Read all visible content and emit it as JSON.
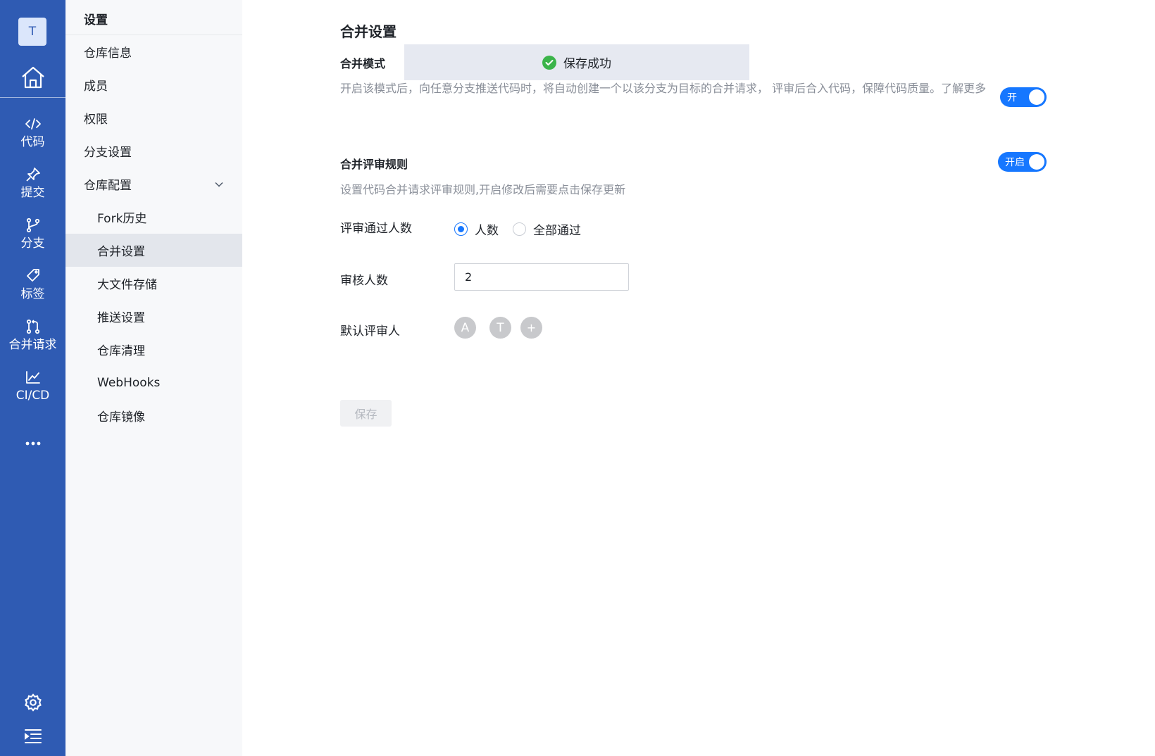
{
  "rail": {
    "avatar_letter": "T",
    "items": [
      {
        "label": "代码",
        "icon": "code-icon"
      },
      {
        "label": "提交",
        "icon": "pin-icon"
      },
      {
        "label": "分支",
        "icon": "branch-icon"
      },
      {
        "label": "标签",
        "icon": "tag-icon"
      },
      {
        "label": "合并请求",
        "icon": "merge-request-icon"
      },
      {
        "label": "CI/CD",
        "icon": "chart-line-icon"
      }
    ],
    "more_label": "•••"
  },
  "sidebar": {
    "title": "设置",
    "items": [
      {
        "label": "仓库信息"
      },
      {
        "label": "成员"
      },
      {
        "label": "权限"
      },
      {
        "label": "分支设置"
      },
      {
        "label": "仓库配置"
      }
    ],
    "sub_items": [
      {
        "label": "Fork历史"
      },
      {
        "label": "合并设置"
      },
      {
        "label": "大文件存储"
      },
      {
        "label": "推送设置"
      },
      {
        "label": "仓库清理"
      },
      {
        "label": "WebHooks"
      },
      {
        "label": "仓库镜像"
      }
    ]
  },
  "main": {
    "title": "合并设置",
    "merge_mode": {
      "title": "合并模式",
      "desc": "开启该模式后，向任意分支推送代码时，将自动创建一个以该分支为目标的合并请求， 评审后合入代码，保障代码质量。了解更多",
      "toggle_label": "开"
    },
    "toast": {
      "text": "保存成功"
    },
    "review_rules": {
      "title": "合并评审规则",
      "toggle_label": "开启",
      "desc": "设置代码合并请求评审规则,开启修改后需要点击保存更新",
      "pass_label": "评审通过人数",
      "radio_count": "人数",
      "radio_all": "全部通过",
      "reviewer_count_label": "审核人数",
      "reviewer_count_value": "2",
      "default_reviewers_label": "默认评审人",
      "reviewers": [
        "A",
        "T"
      ],
      "add_label": "+"
    },
    "save_label": "保存"
  },
  "colors": {
    "rail_bg": "#2f5bb3",
    "accent": "#1677ff",
    "success": "#3bb44a"
  }
}
